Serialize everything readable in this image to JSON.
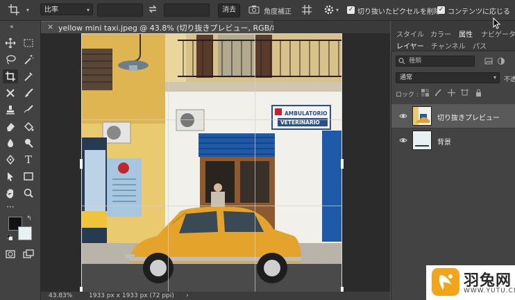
{
  "options_bar": {
    "ratio_select": "比率",
    "clear_button": "消去",
    "straighten_label": "角度補正",
    "delete_cropped_label": "切り抜いたピクセルを削除",
    "content_aware_label": "コンテンツに応じる",
    "delete_cropped_checked": "✓",
    "content_aware_checked": "✓"
  },
  "document": {
    "tab_title": "yellow mini taxi.jpeg @ 43.8% (切り抜きプレビュー, RGB/8) *",
    "close_glyph": "×",
    "sign_text_1": "AMBULATORIO",
    "sign_text_2": "VETERINARIO"
  },
  "status_bar": {
    "zoom": "43.83%",
    "doc_size": "1933 px x 1933 px (72 ppi)",
    "arrow": "›"
  },
  "panels": {
    "top_tabs": [
      "スタイル",
      "カラー",
      "属性",
      "ナビゲータ"
    ],
    "sub_tabs": [
      "レイヤー",
      "チャンネル",
      "パス"
    ],
    "filter_placeholder": "種類",
    "blend_mode": "通常",
    "opacity_label": "不透",
    "lock_label": "ロック :",
    "layers": [
      {
        "name": "切り抜きプレビュー"
      },
      {
        "name": "背景"
      }
    ]
  },
  "watermark": {
    "name": "羽兔网",
    "url": "WWW.YUTU.CN"
  },
  "colors": {
    "accent": "#f2a51a",
    "car": "#e4a32b",
    "foreground": "#111118",
    "background": "#e8f2f2"
  }
}
